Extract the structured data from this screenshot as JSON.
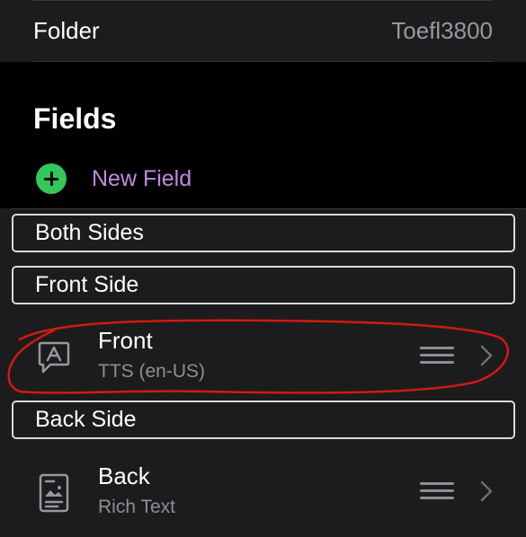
{
  "folder": {
    "label": "Folder",
    "value": "Toefl3800"
  },
  "fields_section": {
    "title": "Fields",
    "new_field_label": "New Field"
  },
  "groups": {
    "both_sides": "Both Sides",
    "front_side": "Front Side",
    "back_side": "Back Side"
  },
  "fields": [
    {
      "name": "Front",
      "type": "TTS (en-US)",
      "icon": "speech-bubble-a-icon"
    },
    {
      "name": "Back",
      "type": "Rich Text",
      "icon": "rich-text-document-icon"
    }
  ],
  "colors": {
    "accent_green": "#34c759",
    "new_field_purple": "#bf8be0",
    "annotation_red": "#d11a10"
  }
}
